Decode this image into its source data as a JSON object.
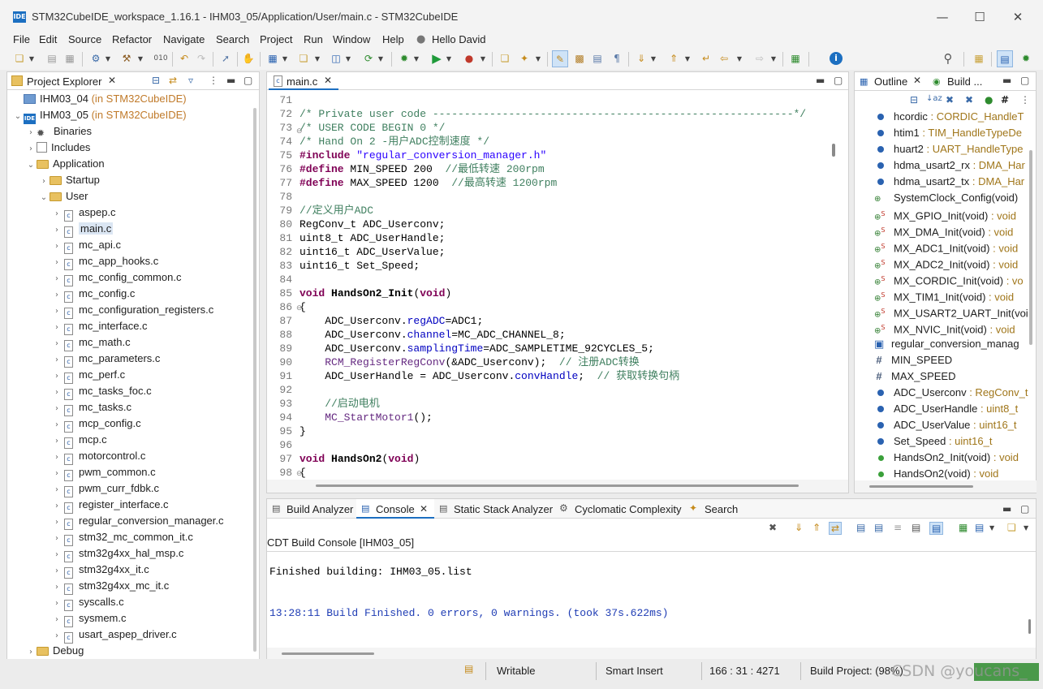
{
  "window": {
    "title": "STM32CubeIDE_workspace_1.16.1 - IHM03_05/Application/User/main.c - STM32CubeIDE",
    "app_icon_text": "IDE"
  },
  "menu": [
    "File",
    "Edit",
    "Source",
    "Refactor",
    "Navigate",
    "Search",
    "Project",
    "Run",
    "Window",
    "Help"
  ],
  "user_label": "Hello David",
  "project_explorer": {
    "title": "Project Explorer",
    "items": [
      {
        "label": "IHM03_04",
        "suffix": " (in STM32CubeIDE)"
      },
      {
        "label": "IHM03_05",
        "suffix": " (in STM32CubeIDE)"
      },
      {
        "label": "Binaries"
      },
      {
        "label": "Includes"
      },
      {
        "label": "Application"
      },
      {
        "label": "Startup"
      },
      {
        "label": "User"
      },
      {
        "label": "aspep.c"
      },
      {
        "label": "main.c"
      },
      {
        "label": "mc_api.c"
      },
      {
        "label": "mc_app_hooks.c"
      },
      {
        "label": "mc_config_common.c"
      },
      {
        "label": "mc_config.c"
      },
      {
        "label": "mc_configuration_registers.c"
      },
      {
        "label": "mc_interface.c"
      },
      {
        "label": "mc_math.c"
      },
      {
        "label": "mc_parameters.c"
      },
      {
        "label": "mc_perf.c"
      },
      {
        "label": "mc_tasks_foc.c"
      },
      {
        "label": "mc_tasks.c"
      },
      {
        "label": "mcp_config.c"
      },
      {
        "label": "mcp.c"
      },
      {
        "label": "motorcontrol.c"
      },
      {
        "label": "pwm_common.c"
      },
      {
        "label": "pwm_curr_fdbk.c"
      },
      {
        "label": "register_interface.c"
      },
      {
        "label": "regular_conversion_manager.c"
      },
      {
        "label": "stm32_mc_common_it.c"
      },
      {
        "label": "stm32g4xx_hal_msp.c"
      },
      {
        "label": "stm32g4xx_it.c"
      },
      {
        "label": "stm32g4xx_mc_it.c"
      },
      {
        "label": "syscalls.c"
      },
      {
        "label": "sysmem.c"
      },
      {
        "label": "usart_aspep_driver.c"
      },
      {
        "label": "Debug"
      }
    ]
  },
  "editor": {
    "tab": "main.c",
    "line_numbers": [
      "71",
      "72",
      "73",
      "74",
      "75",
      "76",
      "77",
      "78",
      "79",
      "80",
      "81",
      "82",
      "83",
      "84",
      "85",
      "86",
      "87",
      "88",
      "89",
      "90",
      "91",
      "92",
      "93",
      "94",
      "95",
      "96",
      "97",
      "98"
    ],
    "lines": [
      "",
      "/* Private user code ---------------------------------------------------------*/",
      "/* USER CODE BEGIN 0 */",
      "/* Hand On 2 -用户ADC控制速度 */",
      "#include \"regular_conversion_manager.h\"",
      "#define MIN_SPEED 200  //最低转速 200rpm",
      "#define MAX_SPEED 1200  //最高转速 1200rpm",
      "",
      "//定义用户ADC",
      "RegConv_t ADC_Userconv;",
      "uint8_t ADC_UserHandle;",
      "uint16_t ADC_UserValue;",
      "uint16_t Set_Speed;",
      "",
      "void HandsOn2_Init(void)",
      "{",
      "    ADC_Userconv.regADC=ADC1;",
      "    ADC_Userconv.channel=MC_ADC_CHANNEL_8;",
      "    ADC_Userconv.samplingTime=ADC_SAMPLETIME_92CYCLES_5;",
      "    RCM_RegisterRegConv(&ADC_Userconv);  // 注册ADC转换",
      "    ADC_UserHandle = ADC_Userconv.convHandle;  // 获取转换句柄",
      "",
      "    //启动电机",
      "    MC_StartMotor1();",
      "}",
      "",
      "void HandsOn2(void)",
      "{"
    ]
  },
  "outline": {
    "tab1": "Outline",
    "tab2": "Build ...",
    "items": [
      {
        "name": "hcordic",
        "type": " : CORDIC_HandleT"
      },
      {
        "name": "htim1",
        "type": " : TIM_HandleTypeDe"
      },
      {
        "name": "huart2",
        "type": " : UART_HandleType"
      },
      {
        "name": "hdma_usart2_rx",
        "type": " : DMA_Har"
      },
      {
        "name": "hdma_usart2_tx",
        "type": " : DMA_Har"
      },
      {
        "name": "SystemClock_Config(void)",
        "type": ""
      },
      {
        "name": "MX_GPIO_Init(void)",
        "type": " : void"
      },
      {
        "name": "MX_DMA_Init(void)",
        "type": " : void"
      },
      {
        "name": "MX_ADC1_Init(void)",
        "type": " : void"
      },
      {
        "name": "MX_ADC2_Init(void)",
        "type": " : void"
      },
      {
        "name": "MX_CORDIC_Init(void)",
        "type": " : vo"
      },
      {
        "name": "MX_TIM1_Init(void)",
        "type": " : void"
      },
      {
        "name": "MX_USART2_UART_Init(voi",
        "type": ""
      },
      {
        "name": "MX_NVIC_Init(void)",
        "type": " : void"
      },
      {
        "name": "regular_conversion_manag",
        "type": ""
      },
      {
        "name": "MIN_SPEED",
        "type": ""
      },
      {
        "name": "MAX_SPEED",
        "type": ""
      },
      {
        "name": "ADC_Userconv",
        "type": " : RegConv_t"
      },
      {
        "name": "ADC_UserHandle",
        "type": " : uint8_t"
      },
      {
        "name": "ADC_UserValue",
        "type": " : uint16_t"
      },
      {
        "name": "Set_Speed",
        "type": " : uint16_t"
      },
      {
        "name": "HandsOn2_Init(void)",
        "type": " : void"
      },
      {
        "name": "HandsOn2(void)",
        "type": " : void"
      }
    ]
  },
  "bottom": {
    "tabs": [
      "Build Analyzer",
      "Console",
      "Static Stack Analyzer",
      "Cyclomatic Complexity",
      "Search"
    ],
    "console_title": "CDT Build Console [IHM03_05]",
    "console_line1": "Finished building: IHM03_05.list",
    "console_line2": "13:28:11 Build Finished. 0 errors, 0 warnings. (took 37s.622ms)"
  },
  "status": {
    "writable": "Writable",
    "insert_mode": "Smart Insert",
    "position": "166 : 31 : 4271",
    "build": "Build Project: (98%)",
    "watermark": "CSDN @youcans_"
  },
  "colors": {
    "accent": "#1c6fc1",
    "comment": "#3f7f5f",
    "keyword": "#7f0055",
    "string": "#2a00ff",
    "field": "#0000c0",
    "console_blue": "#1e3cb4",
    "outline_type": "#a0761a"
  }
}
